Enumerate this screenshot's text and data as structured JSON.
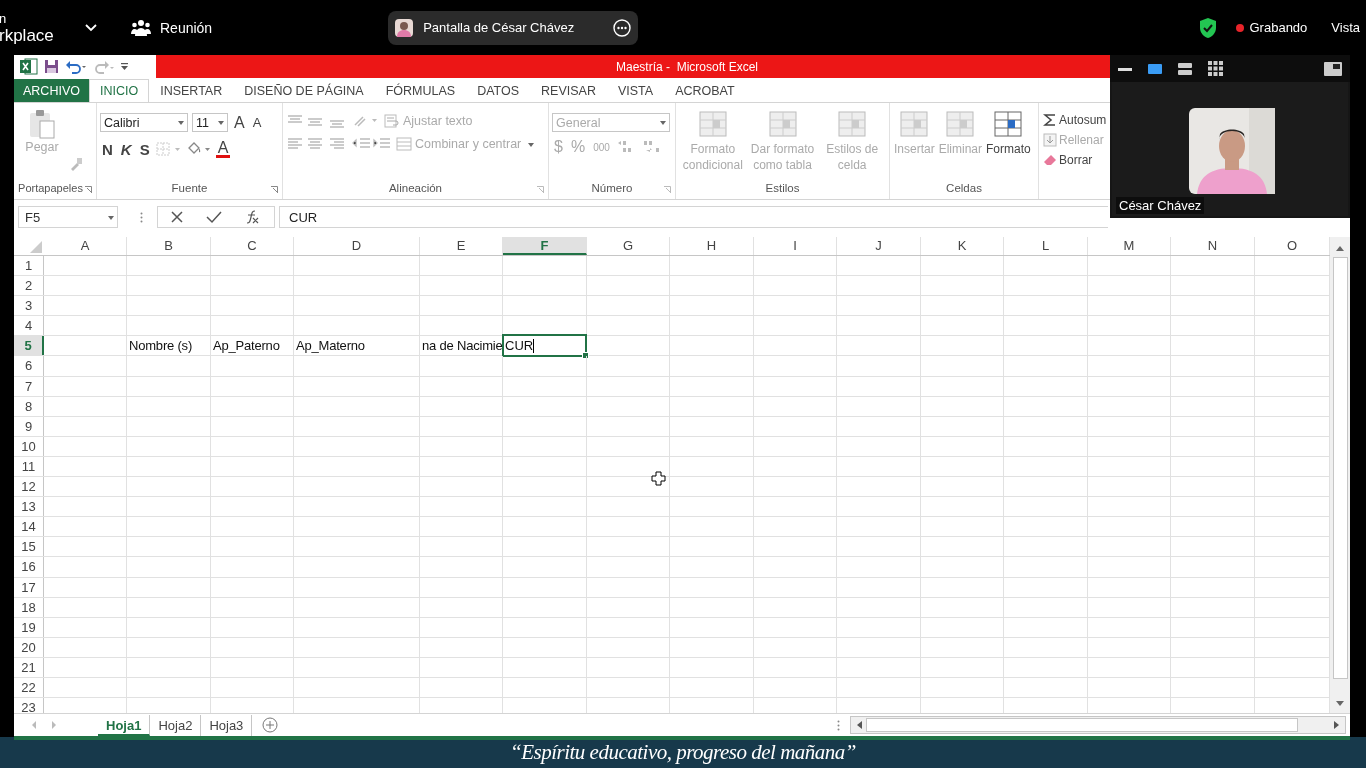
{
  "meeting_bar": {
    "app_name": [
      "n",
      "rkplace"
    ],
    "meeting_label": "Reunión",
    "share_pill": "Pantalla de César Chávez",
    "recording": "Grabando",
    "view": "Vista"
  },
  "excel": {
    "title": "Maestría -  Microsoft Excel",
    "tabs": [
      {
        "label": "ARCHIVO",
        "kind": "file",
        "selected": false
      },
      {
        "label": "INICIO",
        "kind": "tab",
        "selected": true
      },
      {
        "label": "INSERTAR",
        "kind": "tab",
        "selected": false
      },
      {
        "label": "DISEÑO DE PÁGINA",
        "kind": "tab",
        "selected": false
      },
      {
        "label": "FÓRMULAS",
        "kind": "tab",
        "selected": false
      },
      {
        "label": "DATOS",
        "kind": "tab",
        "selected": false
      },
      {
        "label": "REVISAR",
        "kind": "tab",
        "selected": false
      },
      {
        "label": "VISTA",
        "kind": "tab",
        "selected": false
      },
      {
        "label": "ACROBAT",
        "kind": "tab",
        "selected": false
      }
    ],
    "ribbon": [
      {
        "kind": "clipboard",
        "name": "Portapapeles",
        "paste": {
          "label": "Pegar",
          "disabled": true
        }
      },
      {
        "kind": "font",
        "name": "Fuente",
        "font": "Calibri",
        "size": "11",
        "grow": "A",
        "shrink": "A",
        "bold": "N",
        "italic": "K",
        "underline": "S",
        "font_color": "A"
      },
      {
        "kind": "alignment",
        "name": "Alineación",
        "wrap": {
          "label": "Ajustar texto",
          "disabled": true
        },
        "merge": {
          "label": "Combinar y centrar",
          "disabled": true
        }
      },
      {
        "kind": "number",
        "name": "Número",
        "format": {
          "value": "General",
          "disabled": true
        },
        "currency": "$",
        "percent": "%",
        "thousands": "000"
      },
      {
        "kind": "large",
        "name": "Estilos",
        "items": [
          {
            "label": "Formato condicional",
            "disabled": true
          },
          {
            "label": "Dar formato como tabla",
            "disabled": true
          },
          {
            "label": "Estilos de celda",
            "disabled": true
          }
        ]
      },
      {
        "kind": "large",
        "name": "Celdas",
        "items": [
          {
            "label": "Insertar",
            "disabled": true
          },
          {
            "label": "Eliminar",
            "disabled": true
          },
          {
            "label": "Formato",
            "disabled": false
          }
        ]
      },
      {
        "kind": "editing",
        "items": [
          {
            "label": "Autosum",
            "disabled": false
          },
          {
            "label": "Rellenar",
            "disabled": true
          },
          {
            "label": "Borrar",
            "disabled": false
          }
        ]
      }
    ],
    "name_box": "F5",
    "formula": "CUR",
    "columns": [
      {
        "label": "A",
        "selected": false
      },
      {
        "label": "B",
        "selected": false
      },
      {
        "label": "C",
        "selected": false
      },
      {
        "label": "D",
        "selected": false
      },
      {
        "label": "E",
        "selected": false
      },
      {
        "label": "F",
        "selected": true
      },
      {
        "label": "G",
        "selected": false
      },
      {
        "label": "H",
        "selected": false
      },
      {
        "label": "I",
        "selected": false
      },
      {
        "label": "J",
        "selected": false
      },
      {
        "label": "K",
        "selected": false
      },
      {
        "label": "L",
        "selected": false
      },
      {
        "label": "M",
        "selected": false
      },
      {
        "label": "N",
        "selected": false
      },
      {
        "label": "O",
        "selected": false
      }
    ],
    "rows": [
      {
        "number": "1",
        "selected": false
      },
      {
        "number": "2",
        "selected": false
      },
      {
        "number": "3",
        "selected": false
      },
      {
        "number": "4",
        "selected": false
      },
      {
        "number": "5",
        "selected": true,
        "cells": [
          {
            "selected": false
          },
          {
            "value": "Nombre (s)",
            "selected": false
          },
          {
            "value": "Ap_Paterno",
            "selected": false
          },
          {
            "value": "Ap_Materno",
            "selected": false
          },
          {
            "value": "na de Nacimie",
            "selected": false
          },
          {
            "value": "CUR",
            "selected": true
          }
        ]
      },
      {
        "number": "6",
        "selected": false
      },
      {
        "number": "7",
        "selected": false
      },
      {
        "number": "8",
        "selected": false
      },
      {
        "number": "9",
        "selected": false
      },
      {
        "number": "10",
        "selected": false
      },
      {
        "number": "11",
        "selected": false
      },
      {
        "number": "12",
        "selected": false
      },
      {
        "number": "13",
        "selected": false
      },
      {
        "number": "14",
        "selected": false
      },
      {
        "number": "15",
        "selected": false
      },
      {
        "number": "16",
        "selected": false
      },
      {
        "number": "17",
        "selected": false
      },
      {
        "number": "18",
        "selected": false
      },
      {
        "number": "19",
        "selected": false
      },
      {
        "number": "20",
        "selected": false
      },
      {
        "number": "21",
        "selected": false
      },
      {
        "number": "22",
        "selected": false
      },
      {
        "number": "23",
        "selected": false
      }
    ],
    "sheets": [
      {
        "label": "Hoja1",
        "selected": true
      },
      {
        "label": "Hoja2",
        "selected": false
      },
      {
        "label": "Hoja3",
        "selected": false
      }
    ]
  },
  "video_panel": {
    "participant": "César Chávez"
  },
  "banner": "“Espíritu educativo, progreso del mañana”"
}
